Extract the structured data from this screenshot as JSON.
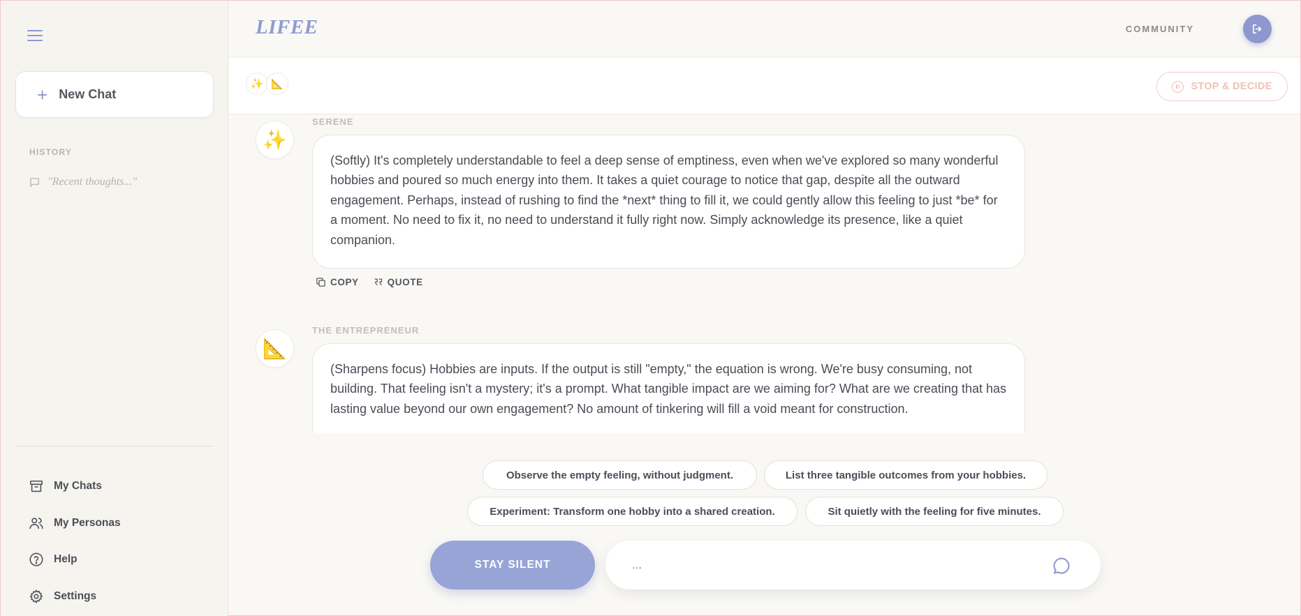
{
  "sidebar": {
    "new_chat": "New Chat",
    "history_title": "HISTORY",
    "history_items": [
      "\"Recent thoughts...\""
    ],
    "menu": {
      "my_chats": "My Chats",
      "my_personas": "My Personas",
      "help": "Help",
      "settings": "Settings"
    }
  },
  "header": {
    "logo": "LIFEE",
    "community": "COMMUNITY"
  },
  "persona_bar": {
    "personas": [
      "sparkles",
      "triangle-ruler"
    ],
    "stop_label": "STOP & DECIDE"
  },
  "messages": [
    {
      "name": "SERENE",
      "avatar": "✨",
      "text": "(Softly) It's completely understandable to feel a deep sense of emptiness, even when we've explored so many wonderful hobbies and poured so much energy into them. It takes a quiet courage to notice that gap, despite all the outward engagement. Perhaps, instead of rushing to find the *next* thing to fill it, we could gently allow this feeling to just *be* for a moment. No need to fix it, no need to understand it fully right now. Simply acknowledge its presence, like a quiet companion.",
      "copy_label": "COPY",
      "quote_label": "QUOTE"
    },
    {
      "name": "THE ENTREPRENEUR",
      "avatar": "📐",
      "text": "(Sharpens focus) Hobbies are inputs. If the output is still \"empty,\" the equation is wrong. We're busy consuming, not building. That feeling isn't a mystery; it's a prompt. What tangible impact are we aiming for? What are we creating that has lasting value beyond our own engagement? No amount of tinkering will fill a void meant for construction."
    }
  ],
  "suggestions": [
    "Observe the empty feeling, without judgment.",
    "List three tangible outcomes from your hobbies.",
    "Experiment: Transform one hobby into a shared creation.",
    "Sit quietly with the feeling for five minutes."
  ],
  "composer": {
    "stay_silent": "STAY SILENT",
    "placeholder": "..."
  },
  "colors": {
    "accent": "#8e98cf",
    "stop": "#f1c1b8",
    "background": "#f9f8f5"
  }
}
